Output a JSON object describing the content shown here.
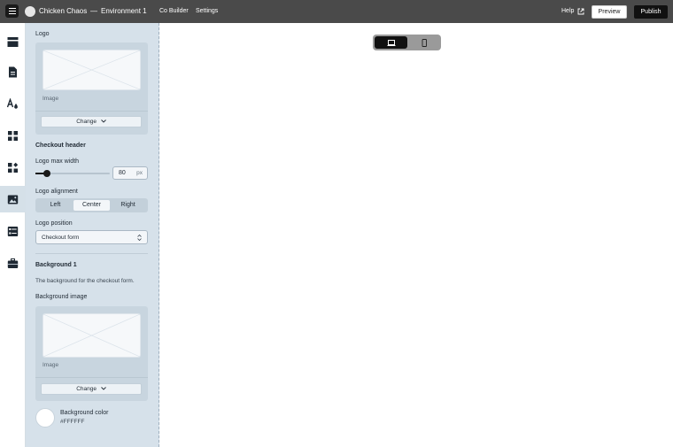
{
  "header": {
    "app_name": "Chicken Chaos",
    "separator": "—",
    "environment": "Environment 1",
    "nav": [
      "Co Builder",
      "Settings"
    ],
    "help_label": "Help",
    "preview_label": "Preview",
    "publish_label": "Publish"
  },
  "rail": {
    "icons": [
      "layout-icon",
      "document-icon",
      "typography-icon",
      "grid-icon",
      "puzzle-icon",
      "image-icon",
      "list-icon",
      "briefcase-icon"
    ],
    "active": "image-icon"
  },
  "panel": {
    "logo_label": "Logo",
    "logo_image_caption": "Image",
    "logo_change_label": "Change",
    "checkout_header_title": "Checkout header",
    "logo_max_width_label": "Logo max width",
    "logo_max_width_value": "80",
    "logo_max_width_unit": "px",
    "logo_max_width_slider_fraction": 0.15,
    "logo_alignment_label": "Logo alignment",
    "alignment_options": [
      "Left",
      "Center",
      "Right"
    ],
    "alignment_selected": "Center",
    "logo_position_label": "Logo position",
    "logo_position_value": "Checkout form",
    "background_title": "Background 1",
    "background_desc": "The background for the checkout form.",
    "background_image_label": "Background image",
    "background_image_caption": "Image",
    "background_change_label": "Change",
    "background_color_label": "Background color",
    "background_color_value": "#FFFFFF"
  },
  "canvas": {
    "device_options": [
      "desktop-icon",
      "mobile-icon"
    ],
    "device_selected": "desktop-icon"
  },
  "colors": {
    "topbar": "#4a4a4a",
    "panel": "#d6e1ea",
    "accent_dark": "#111111"
  }
}
